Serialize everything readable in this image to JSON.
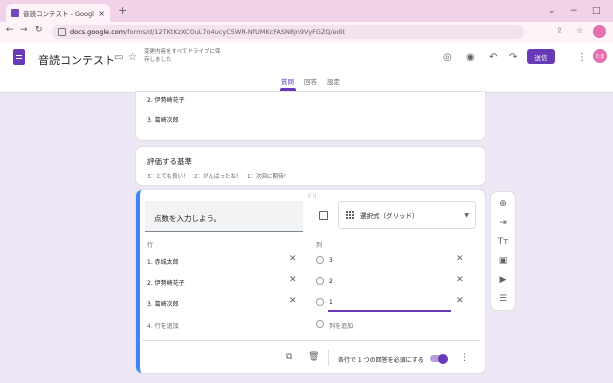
{
  "browser": {
    "tab_title": "音読コンテスト - Google フォーム",
    "tab_close": "×",
    "new_tab": "+",
    "url_host": "docs.google.com",
    "url_path": "/forms/d/12TKtKzXCOuL7o4ucyC5WR-NfUMKcFASN8jn9VyFGZQ/edit",
    "window_controls": [
      "⌄",
      "−",
      "□"
    ]
  },
  "header": {
    "form_title": "音読コンテスト",
    "autosave_text": "変更内容をすべてドライブに保存しました",
    "send_label": "送信",
    "avatar_initials": "たま",
    "tabs": [
      "質問",
      "回答",
      "設定"
    ]
  },
  "card1": {
    "items": [
      "2. 伊勢崎花子",
      "3. 葛崎次郎"
    ]
  },
  "card2": {
    "title": "評価する基準",
    "description": "3：とても良い！　2：がんばったね！　1：次回に期待！"
  },
  "question": {
    "title": "点数を入力しよう。",
    "type_label": "選択式（グリッド）",
    "rows_header": "行",
    "cols_header": "列",
    "rows": [
      "1. 赤城太郎",
      "2. 伊勢崎花子",
      "3. 葛崎次郎"
    ],
    "add_row": "4. 行を追加",
    "columns": [
      "3",
      "2",
      "1"
    ],
    "add_column": "列を追加",
    "required_label": "各行で 1 つの回答を必須にする"
  },
  "colors": {
    "accent": "#673ab7",
    "focus_border": "#4285f4",
    "background": "#ede7f6",
    "chrome_tab": "#f2d2e6"
  },
  "icons": [
    "google-forms-icon",
    "folder-icon",
    "star-icon",
    "palette-icon",
    "preview-icon",
    "undo-icon",
    "redo-icon",
    "more-vert-icon",
    "image-icon",
    "grid-icon",
    "copy-icon",
    "trash-icon",
    "add-circle-icon",
    "import-icon",
    "title-icon",
    "video-icon",
    "section-icon"
  ]
}
